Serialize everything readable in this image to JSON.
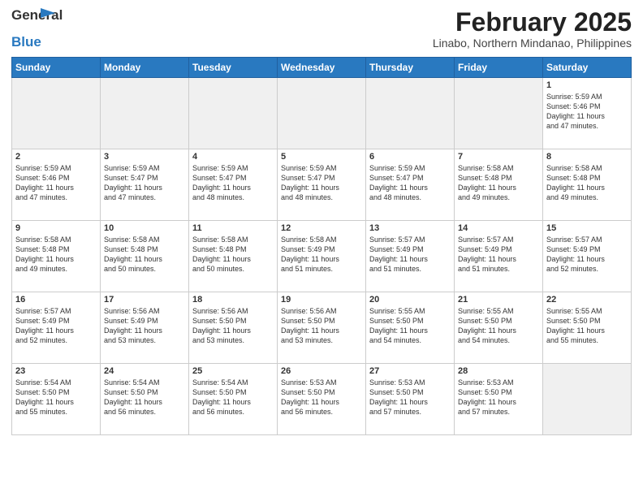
{
  "header": {
    "logo_line1": "General",
    "logo_line2": "Blue",
    "title": "February 2025",
    "subtitle": "Linabo, Northern Mindanao, Philippines"
  },
  "days_of_week": [
    "Sunday",
    "Monday",
    "Tuesday",
    "Wednesday",
    "Thursday",
    "Friday",
    "Saturday"
  ],
  "weeks": [
    [
      {
        "day": "",
        "info": ""
      },
      {
        "day": "",
        "info": ""
      },
      {
        "day": "",
        "info": ""
      },
      {
        "day": "",
        "info": ""
      },
      {
        "day": "",
        "info": ""
      },
      {
        "day": "",
        "info": ""
      },
      {
        "day": "1",
        "info": "Sunrise: 5:59 AM\nSunset: 5:46 PM\nDaylight: 11 hours\nand 47 minutes."
      }
    ],
    [
      {
        "day": "2",
        "info": "Sunrise: 5:59 AM\nSunset: 5:46 PM\nDaylight: 11 hours\nand 47 minutes."
      },
      {
        "day": "3",
        "info": "Sunrise: 5:59 AM\nSunset: 5:47 PM\nDaylight: 11 hours\nand 47 minutes."
      },
      {
        "day": "4",
        "info": "Sunrise: 5:59 AM\nSunset: 5:47 PM\nDaylight: 11 hours\nand 48 minutes."
      },
      {
        "day": "5",
        "info": "Sunrise: 5:59 AM\nSunset: 5:47 PM\nDaylight: 11 hours\nand 48 minutes."
      },
      {
        "day": "6",
        "info": "Sunrise: 5:59 AM\nSunset: 5:47 PM\nDaylight: 11 hours\nand 48 minutes."
      },
      {
        "day": "7",
        "info": "Sunrise: 5:58 AM\nSunset: 5:48 PM\nDaylight: 11 hours\nand 49 minutes."
      },
      {
        "day": "8",
        "info": "Sunrise: 5:58 AM\nSunset: 5:48 PM\nDaylight: 11 hours\nand 49 minutes."
      }
    ],
    [
      {
        "day": "9",
        "info": "Sunrise: 5:58 AM\nSunset: 5:48 PM\nDaylight: 11 hours\nand 49 minutes."
      },
      {
        "day": "10",
        "info": "Sunrise: 5:58 AM\nSunset: 5:48 PM\nDaylight: 11 hours\nand 50 minutes."
      },
      {
        "day": "11",
        "info": "Sunrise: 5:58 AM\nSunset: 5:48 PM\nDaylight: 11 hours\nand 50 minutes."
      },
      {
        "day": "12",
        "info": "Sunrise: 5:58 AM\nSunset: 5:49 PM\nDaylight: 11 hours\nand 51 minutes."
      },
      {
        "day": "13",
        "info": "Sunrise: 5:57 AM\nSunset: 5:49 PM\nDaylight: 11 hours\nand 51 minutes."
      },
      {
        "day": "14",
        "info": "Sunrise: 5:57 AM\nSunset: 5:49 PM\nDaylight: 11 hours\nand 51 minutes."
      },
      {
        "day": "15",
        "info": "Sunrise: 5:57 AM\nSunset: 5:49 PM\nDaylight: 11 hours\nand 52 minutes."
      }
    ],
    [
      {
        "day": "16",
        "info": "Sunrise: 5:57 AM\nSunset: 5:49 PM\nDaylight: 11 hours\nand 52 minutes."
      },
      {
        "day": "17",
        "info": "Sunrise: 5:56 AM\nSunset: 5:49 PM\nDaylight: 11 hours\nand 53 minutes."
      },
      {
        "day": "18",
        "info": "Sunrise: 5:56 AM\nSunset: 5:50 PM\nDaylight: 11 hours\nand 53 minutes."
      },
      {
        "day": "19",
        "info": "Sunrise: 5:56 AM\nSunset: 5:50 PM\nDaylight: 11 hours\nand 53 minutes."
      },
      {
        "day": "20",
        "info": "Sunrise: 5:55 AM\nSunset: 5:50 PM\nDaylight: 11 hours\nand 54 minutes."
      },
      {
        "day": "21",
        "info": "Sunrise: 5:55 AM\nSunset: 5:50 PM\nDaylight: 11 hours\nand 54 minutes."
      },
      {
        "day": "22",
        "info": "Sunrise: 5:55 AM\nSunset: 5:50 PM\nDaylight: 11 hours\nand 55 minutes."
      }
    ],
    [
      {
        "day": "23",
        "info": "Sunrise: 5:54 AM\nSunset: 5:50 PM\nDaylight: 11 hours\nand 55 minutes."
      },
      {
        "day": "24",
        "info": "Sunrise: 5:54 AM\nSunset: 5:50 PM\nDaylight: 11 hours\nand 56 minutes."
      },
      {
        "day": "25",
        "info": "Sunrise: 5:54 AM\nSunset: 5:50 PM\nDaylight: 11 hours\nand 56 minutes."
      },
      {
        "day": "26",
        "info": "Sunrise: 5:53 AM\nSunset: 5:50 PM\nDaylight: 11 hours\nand 56 minutes."
      },
      {
        "day": "27",
        "info": "Sunrise: 5:53 AM\nSunset: 5:50 PM\nDaylight: 11 hours\nand 57 minutes."
      },
      {
        "day": "28",
        "info": "Sunrise: 5:53 AM\nSunset: 5:50 PM\nDaylight: 11 hours\nand 57 minutes."
      },
      {
        "day": "",
        "info": ""
      }
    ]
  ]
}
